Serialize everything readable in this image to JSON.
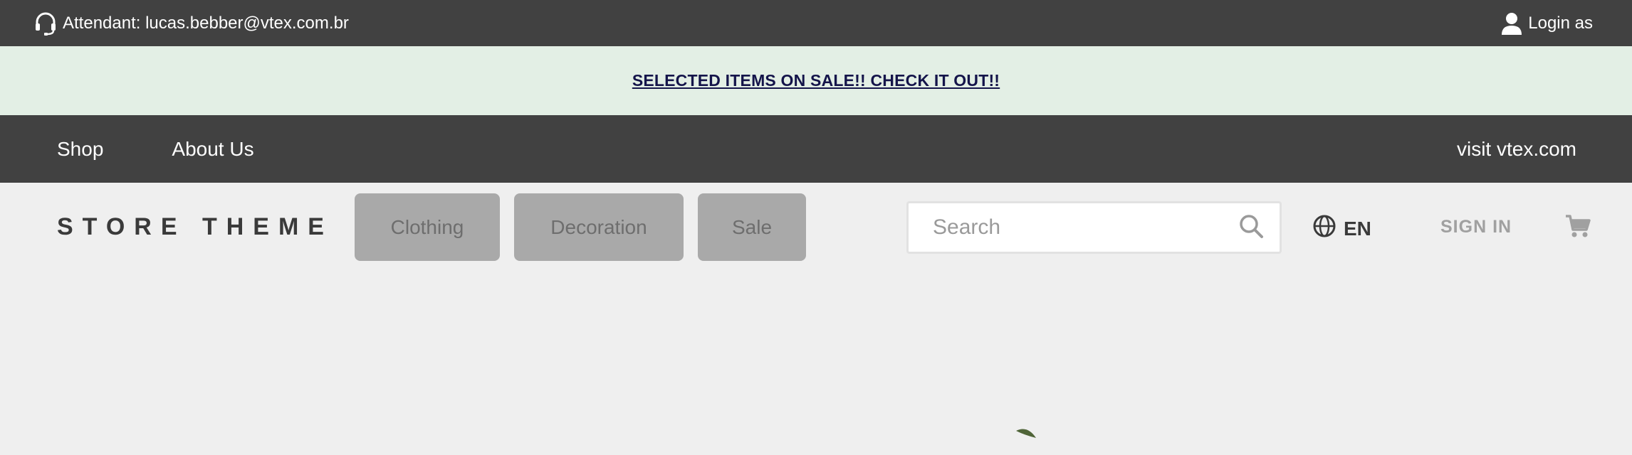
{
  "topbar": {
    "attendant_text": "Attendant: lucas.bebber@vtex.com.br",
    "login_text": "Login as",
    "headset_icon": "headset-icon",
    "user_icon": "user-icon"
  },
  "promo": {
    "text": "SELECTED ITEMS ON SALE!! CHECK IT OUT!!",
    "bg_color": "#e3efe5",
    "text_color": "#14144a"
  },
  "navbar": {
    "links": [
      "Shop",
      "About Us"
    ],
    "external_link": "visit vtex.com"
  },
  "header": {
    "logo": "STORE THEME",
    "categories": [
      "Clothing",
      "Decoration",
      "Sale"
    ],
    "search": {
      "placeholder": "Search",
      "value": ""
    },
    "language": "EN",
    "signin": "SIGN IN",
    "cart_icon": "cart-icon"
  },
  "colors": {
    "dark_bar": "#414141",
    "page_bg": "#efefef",
    "category_bg": "#a9a9a9"
  }
}
